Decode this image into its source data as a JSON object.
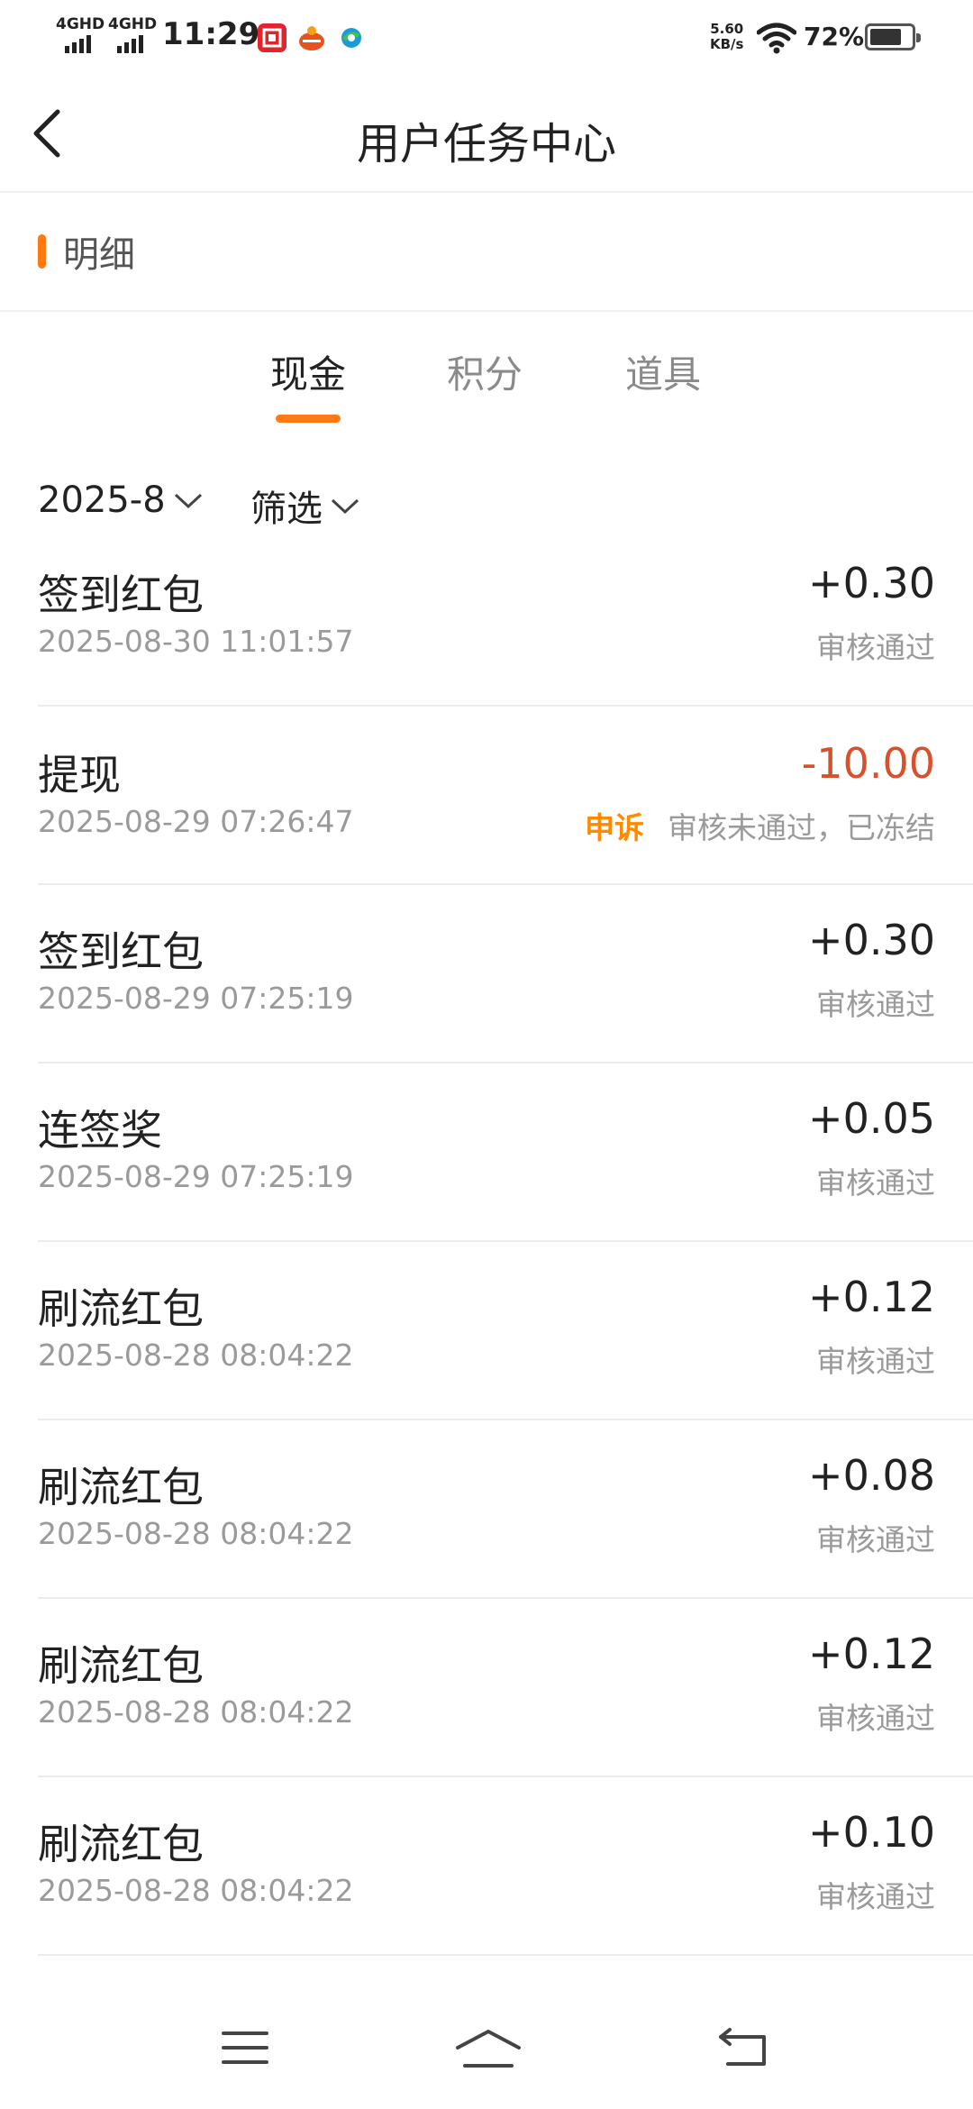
{
  "status_bar": {
    "signal1": "4GHD",
    "signal2": "4GHD",
    "time": "11:29",
    "net_speed_value": "5.60",
    "net_speed_unit": "KB/s",
    "battery": "72%",
    "icons": [
      "citic-bank-app-icon",
      "food-app-icon",
      "browser-app-icon",
      "wifi-icon",
      "battery-icon"
    ]
  },
  "header": {
    "title": "用户任务中心"
  },
  "section": {
    "title": "明细"
  },
  "tabs": [
    {
      "label": "现金",
      "active": true
    },
    {
      "label": "积分",
      "active": false
    },
    {
      "label": "道具",
      "active": false
    }
  ],
  "filters": {
    "month": "2025-8",
    "filter": "筛选"
  },
  "records": [
    {
      "name": "签到红包",
      "time": "2025-08-30 11:01:57",
      "amount": "+0.30",
      "status": "审核通过"
    },
    {
      "name": "提现",
      "time": "2025-08-29 07:26:47",
      "amount": "-10.00",
      "appeal": "申诉",
      "status": "审核未通过，已冻结"
    },
    {
      "name": "签到红包",
      "time": "2025-08-29 07:25:19",
      "amount": "+0.30",
      "status": "审核通过"
    },
    {
      "name": "连签奖",
      "time": "2025-08-29 07:25:19",
      "amount": "+0.05",
      "status": "审核通过"
    },
    {
      "name": "刷流红包",
      "time": "2025-08-28 08:04:22",
      "amount": "+0.12",
      "status": "审核通过"
    },
    {
      "name": "刷流红包",
      "time": "2025-08-28 08:04:22",
      "amount": "+0.08",
      "status": "审核通过"
    },
    {
      "name": "刷流红包",
      "time": "2025-08-28 08:04:22",
      "amount": "+0.12",
      "status": "审核通过"
    },
    {
      "name": "刷流红包",
      "time": "2025-08-28 08:04:22",
      "amount": "+0.10",
      "status": "审核通过"
    }
  ],
  "colors": {
    "accent": "#ff7a13",
    "negative": "#d9512c",
    "appeal": "#ff8a00",
    "muted": "#9a9a9a"
  }
}
